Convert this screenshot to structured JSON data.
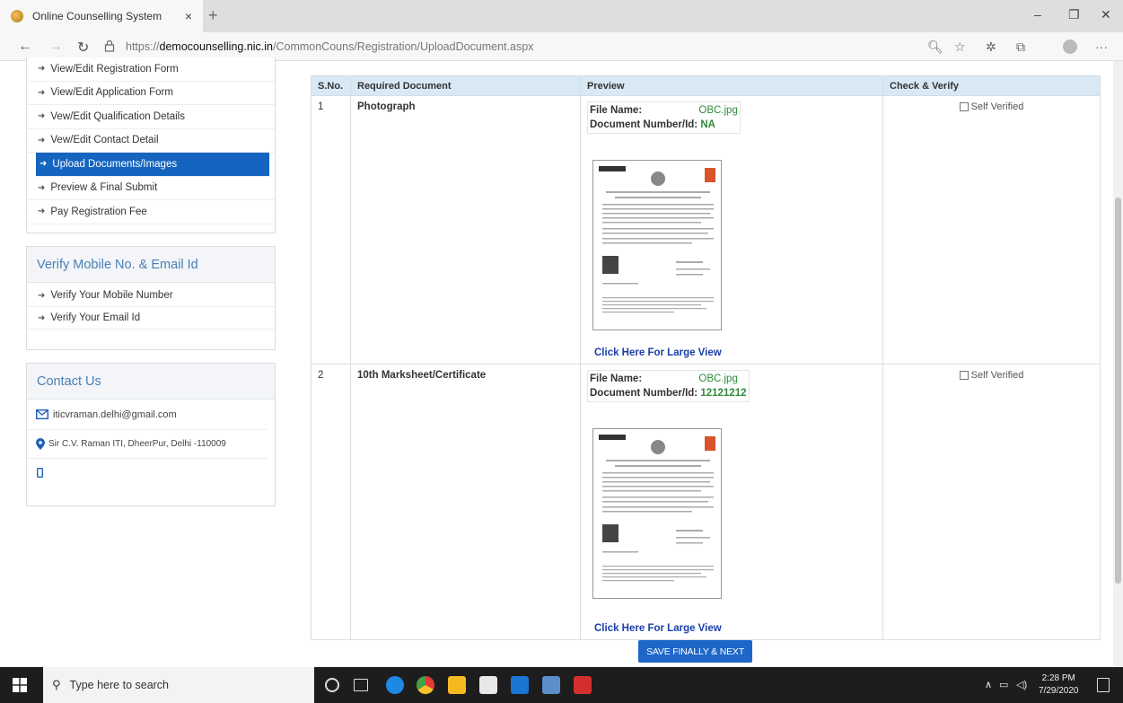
{
  "browser": {
    "tab_title": "Online Counselling System",
    "tab_close": "×",
    "new_tab": "+",
    "url_prefix": "https://",
    "url_host": "democounselling.nic.in",
    "url_path": "/CommonCouns/Registration/UploadDocument.aspx",
    "window_controls": {
      "minimize": "–",
      "restore": "❐",
      "close": "✕"
    }
  },
  "sidebar": {
    "menu": [
      {
        "label": "View/Edit Registration Form",
        "active": false
      },
      {
        "label": "View/Edit Application Form",
        "active": false
      },
      {
        "label": "Vew/Edit Qualification Details",
        "active": false
      },
      {
        "label": "Vew/Edit Contact Detail",
        "active": false
      },
      {
        "label": "Upload Documents/Images",
        "active": true
      },
      {
        "label": "Preview & Final Submit",
        "active": false
      },
      {
        "label": "Pay Registration Fee",
        "active": false
      }
    ],
    "verify": {
      "title": "Verify Mobile No. & Email Id",
      "items": [
        "Verify Your Mobile Number",
        "Verify Your Email Id"
      ]
    },
    "contact": {
      "title": "Contact Us",
      "email": "iticvraman.delhi@gmail.com",
      "address": "Sir C.V. Raman ITI, DheerPur, Delhi -110009"
    }
  },
  "table": {
    "headers": {
      "sno": "S.No.",
      "doc": "Required Document",
      "preview": "Preview",
      "check": "Check & Verify"
    },
    "rows": [
      {
        "sno": "1",
        "doc": "Photograph",
        "file_label": "File Name:",
        "file_name": "OBC.jpg",
        "docnum_label": "Document Number/Id:",
        "docnum": "NA",
        "large_view": "Click Here For Large View",
        "verify": "Self Verified"
      },
      {
        "sno": "2",
        "doc": "10th Marksheet/Certificate",
        "file_label": "File Name:",
        "file_name": "OBC.jpg",
        "docnum_label": "Document Number/Id:",
        "docnum": "12121212",
        "large_view": "Click Here For Large View",
        "verify": "Self Verified"
      }
    ]
  },
  "save_button": "SAVE FINALLY & NEXT",
  "taskbar": {
    "search_placeholder": "Type here to search",
    "time": "2:28 PM",
    "date": "7/29/2020"
  },
  "colors": {
    "active_menu": "#1565c0",
    "header_bg": "#d9e8f5",
    "link": "#1a3fa8",
    "value_green": "#2e8b3a",
    "save": "#1e66c8"
  }
}
